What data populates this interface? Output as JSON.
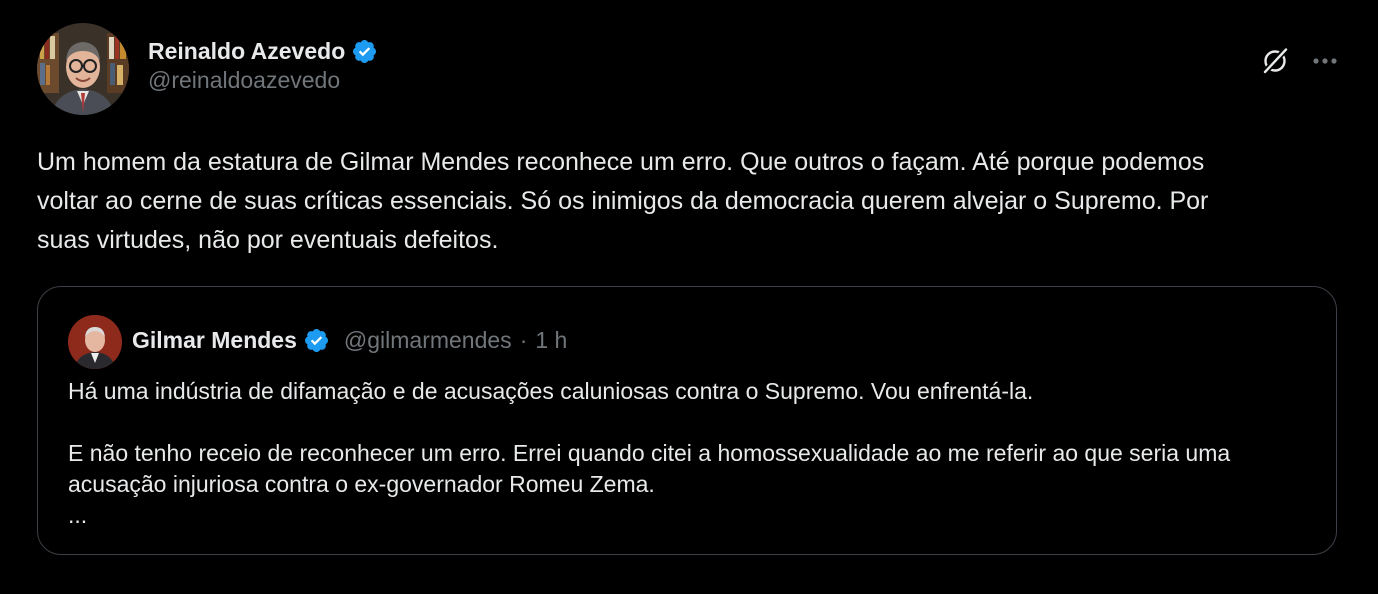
{
  "author": {
    "name": "Reinaldo Azevedo",
    "handle": "@reinaldoazevedo"
  },
  "tweet": {
    "text": "Um homem da estatura de Gilmar Mendes reconhece um erro. Que outros o façam. Até porque podemos\nvoltar ao cerne de suas críticas essenciais. Só os inimigos da democracia querem alvejar o Supremo. Por\nsuas virtudes, não por eventuais defeitos."
  },
  "quoted": {
    "name": "Gilmar Mendes",
    "handle": "@gilmarmendes",
    "separator": "·",
    "time": "1 h",
    "paragraph1": "Há uma indústria de difamação e de acusações caluniosas contra o Supremo. Vou enfrentá-la.",
    "paragraph2_line1": "E não tenho receio de reconhecer um erro. Errei quando citei a homossexualidade ao me referir ao que seria uma",
    "paragraph2_line2": "acusação injuriosa contra o ex-governador Romeu Zema.",
    "ellipsis": "..."
  },
  "icons": {
    "verified": "verified-badge-icon",
    "grok": "grok-icon",
    "more": "more-icon"
  },
  "colors": {
    "background": "#000000",
    "text": "#e7e9ea",
    "muted": "#71767b",
    "verified": "#1d9bf0",
    "border": "#3b4046"
  }
}
